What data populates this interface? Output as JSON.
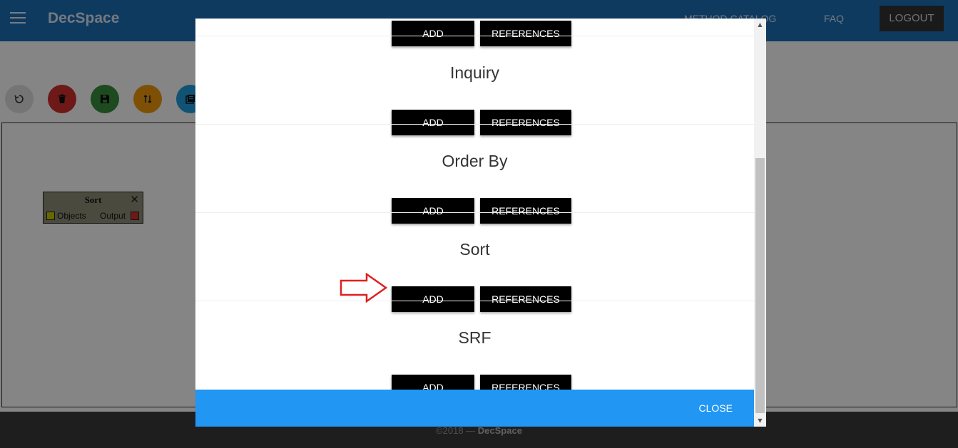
{
  "app": {
    "brand": "DecSpace",
    "nav": {
      "method_catalog": "METHOD CATALOG",
      "faq": "FAQ",
      "logout": "LOGOUT"
    }
  },
  "toolbar": [
    {
      "icon": "undo-icon",
      "color": "#e0e0e0"
    },
    {
      "icon": "trash-icon",
      "color": "#d32f2f"
    },
    {
      "icon": "save-icon",
      "color": "#388e3c"
    },
    {
      "icon": "sort-arrows-icon",
      "color": "#f29a0c"
    },
    {
      "icon": "library-icon",
      "color": "#1f9fe0"
    }
  ],
  "workspace": {
    "node": {
      "title": "Sort",
      "input_label": "Objects",
      "output_label": "Output",
      "input_color": "#c8c800",
      "output_color": "#d32f2f"
    }
  },
  "modal": {
    "sections": [
      {
        "title": "",
        "add": "ADD",
        "references": "REFERENCES"
      },
      {
        "title": "Inquiry",
        "add": "ADD",
        "references": "REFERENCES"
      },
      {
        "title": "Order By",
        "add": "ADD",
        "references": "REFERENCES"
      },
      {
        "title": "Sort",
        "add": "ADD",
        "references": "REFERENCES"
      },
      {
        "title": "SRF",
        "add": "ADD",
        "references": "REFERENCES"
      }
    ],
    "close": "CLOSE",
    "accent": "#2196f3"
  },
  "footer": {
    "copyright": "©2018 — ",
    "brand": "DecSpace"
  }
}
